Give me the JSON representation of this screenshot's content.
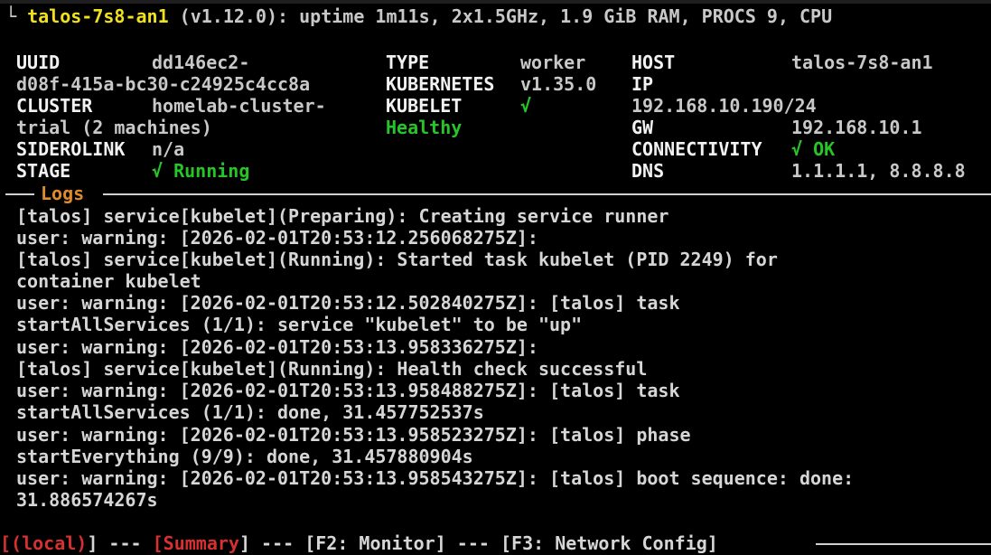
{
  "header": {
    "prefix": "└ ",
    "hostname": "talos-7s8-an1",
    "summary": " (v1.12.0): uptime 1m11s, 2x1.5GHz, 1.9 GiB RAM, PROCS 9, CPU"
  },
  "info": {
    "uuid_label": "UUID",
    "uuid_value_1": "dd146ec2-",
    "uuid_value_2": "d08f-415a-bc30-c24925c4cc8a",
    "cluster_label": "CLUSTER",
    "cluster_value_1": "homelab-cluster-",
    "cluster_value_2": "trial (2 machines)",
    "siderolink_label": "SIDEROLINK",
    "siderolink_value": "n/a",
    "stage_label": "STAGE",
    "stage_value": "√ Running",
    "type_label": "TYPE",
    "type_value": "worker",
    "kubernetes_label": "KUBERNETES",
    "kubernetes_value": "v1.35.0",
    "kubelet_label": "KUBELET",
    "kubelet_value": "√",
    "kubelet_status": "Healthy",
    "host_label": "HOST",
    "host_value": "talos-7s8-an1",
    "ip_label": "IP",
    "ip_value": "192.168.10.190/24",
    "gw_label": "GW",
    "gw_value": "192.168.10.1",
    "connectivity_label": "CONNECTIVITY",
    "connectivity_value": "√ OK",
    "dns_label": "DNS",
    "dns_value": "1.1.1.1, 8.8.8.8"
  },
  "logs": {
    "title": "Logs",
    "lines": [
      "[talos] service[kubelet](Preparing): Creating service runner",
      "user: warning: [2026-02-01T20:53:12.256068275Z]:",
      "[talos] service[kubelet](Running): Started task kubelet (PID 2249) for",
      "container kubelet",
      "user: warning: [2026-02-01T20:53:12.502840275Z]: [talos] task",
      "startAllServices (1/1): service \"kubelet\" to be \"up\"",
      "user: warning: [2026-02-01T20:53:13.958336275Z]:",
      "[talos] service[kubelet](Running): Health check successful",
      "user: warning: [2026-02-01T20:53:13.958488275Z]: [talos] task",
      "startAllServices (1/1): done, 31.457752537s",
      "user: warning: [2026-02-01T20:53:13.958523275Z]: [talos] phase",
      "startEverything (9/9): done, 31.457880904s",
      "user: warning: [2026-02-01T20:53:13.958543275Z]: [talos] boot sequence: done:",
      "31.886574267s"
    ]
  },
  "footer": {
    "open_local": "[",
    "local": "(local)",
    "close_local": "]",
    "sep1": " --- ",
    "open_summary": "[",
    "summary": "Summary",
    "close_summary": "]",
    "sep2": " --- ",
    "monitor": "[F2: Monitor]",
    "sep3": " --- ",
    "network": "[F3: Network Config]"
  }
}
